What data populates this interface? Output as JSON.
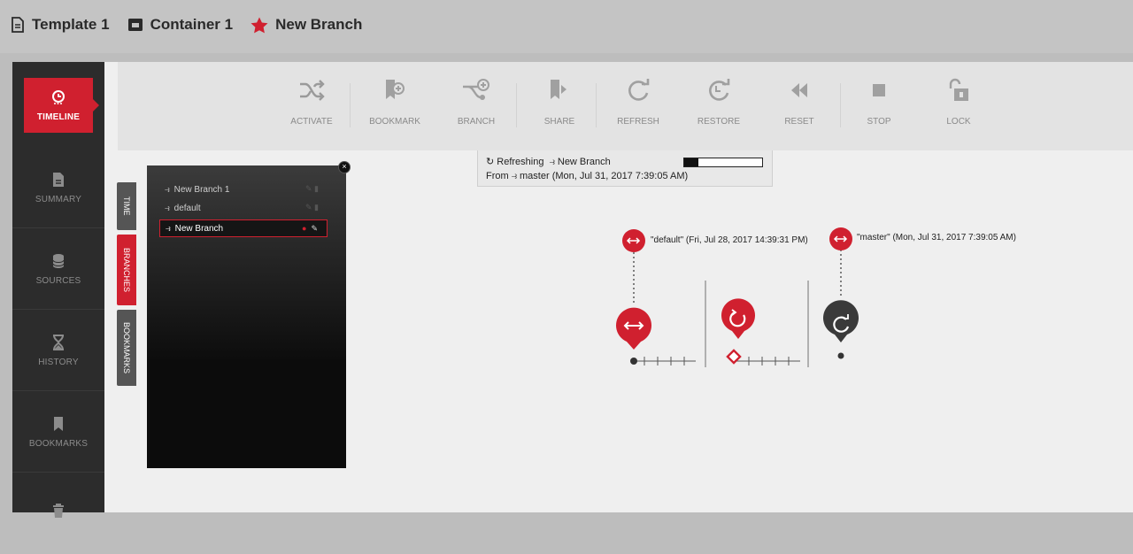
{
  "breadcrumb": [
    {
      "label": "Template 1",
      "icon": "document-icon"
    },
    {
      "label": "Container 1",
      "icon": "container-icon"
    },
    {
      "label": "New Branch",
      "icon": "star-icon"
    }
  ],
  "colors": {
    "accent": "#d0202f",
    "sidebar": "#2c2c2c",
    "toolbar": "#e3e3e3"
  },
  "sidenav": [
    {
      "label": "TIMELINE",
      "icon": "clock-icon",
      "active": true
    },
    {
      "label": "SUMMARY",
      "icon": "file-icon"
    },
    {
      "label": "SOURCES",
      "icon": "database-icon"
    },
    {
      "label": "HISTORY",
      "icon": "hourglass-icon"
    },
    {
      "label": "BOOKMARKS",
      "icon": "bookmark-icon"
    },
    {
      "label": "",
      "icon": "trash-icon"
    }
  ],
  "toolbar": [
    {
      "label": "ACTIVATE",
      "icon": "shuffle-icon"
    },
    {
      "label": "BOOKMARK",
      "icon": "bookmark-add-icon"
    },
    {
      "label": "BRANCH",
      "icon": "branch-add-icon"
    },
    {
      "label": "SHARE",
      "icon": "share-icon"
    },
    {
      "label": "REFRESH",
      "icon": "refresh-icon"
    },
    {
      "label": "RESTORE",
      "icon": "restore-icon"
    },
    {
      "label": "RESET",
      "icon": "rewind-icon"
    },
    {
      "label": "STOP",
      "icon": "stop-icon"
    },
    {
      "label": "LOCK",
      "icon": "lock-icon"
    }
  ],
  "side_tabs": [
    {
      "label": "TIME",
      "icon": "clock-icon",
      "active": false
    },
    {
      "label": "BRANCHES",
      "icon": "branch-icon",
      "active": true
    },
    {
      "label": "BOOKMARKS",
      "icon": "bookmark-icon",
      "active": false
    }
  ],
  "branches": [
    {
      "name": "New Branch 1",
      "selected": false
    },
    {
      "name": "default",
      "selected": false
    },
    {
      "name": "New Branch",
      "selected": true
    }
  ],
  "status": {
    "line1_prefix": "Refreshing",
    "line1_branch": "New Branch",
    "line2_prefix": "From",
    "line2_source": "master (Mon, Jul 31, 2017 7:39:05 AM)",
    "progress": 0.18
  },
  "graph": {
    "default_label": "\"default\" (Fri, Jul 28, 2017 14:39:31 PM)",
    "master_label": "\"master\" (Mon, Jul 31, 2017 7:39:05 AM)"
  }
}
